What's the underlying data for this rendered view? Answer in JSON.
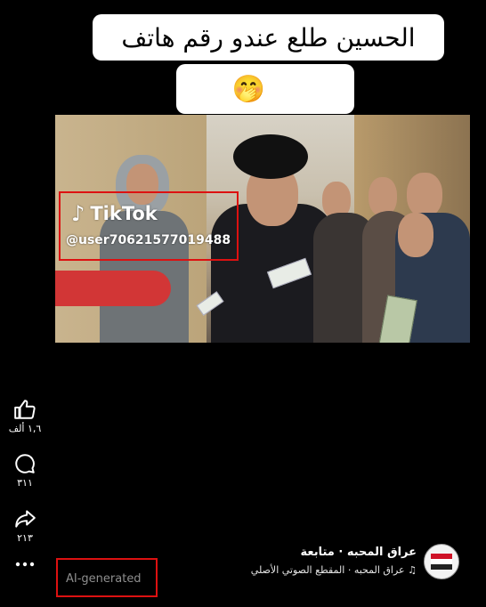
{
  "caption": {
    "text": "الحسين طلع عندو رقم هاتف",
    "emojis": [
      "😂",
      "😁",
      "🤭",
      "😳"
    ]
  },
  "watermark": {
    "brand": "TikTok",
    "user": "@user70621577019488"
  },
  "actions": {
    "like_count": "١,٦ ألف",
    "comment_count": "٣١١",
    "share_count": "٢١٣"
  },
  "badge": {
    "ai_label": "AI-generated"
  },
  "author": {
    "line": "عراق المحبه · متابعة",
    "sound": "عراق المحبه · المقطع الصوتي الأصلي"
  },
  "colors": {
    "annotation": "#dd1111",
    "background": "#000000"
  }
}
